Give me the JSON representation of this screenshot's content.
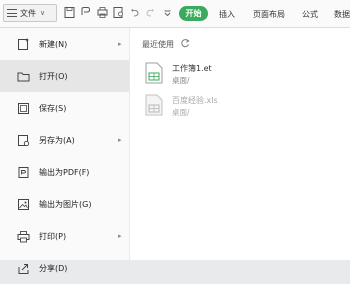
{
  "toolbar": {
    "file_menu_label": "文件",
    "tabs": {
      "start": "开始",
      "insert": "插入",
      "page_layout": "页面布局",
      "formula": "公式",
      "data": "数据"
    },
    "icons": [
      "save-icon",
      "share-icon",
      "print-icon",
      "print-preview-icon",
      "undo-icon",
      "redo-icon",
      "customize-icon"
    ],
    "accent_color": "#3aab5c"
  },
  "sidebar": {
    "items": [
      {
        "label": "新建(N)",
        "icon": "new-doc-icon",
        "has_arrow": true
      },
      {
        "label": "打开(O)",
        "icon": "folder-icon",
        "has_arrow": false
      },
      {
        "label": "保存(S)",
        "icon": "save-icon",
        "has_arrow": false
      },
      {
        "label": "另存为(A)",
        "icon": "save-as-icon",
        "has_arrow": true
      },
      {
        "label": "输出为PDF(F)",
        "icon": "pdf-icon",
        "has_arrow": false
      },
      {
        "label": "输出为图片(G)",
        "icon": "image-icon",
        "has_arrow": false
      },
      {
        "label": "打印(P)",
        "icon": "printer-icon",
        "has_arrow": true
      },
      {
        "label": "分享(D)",
        "icon": "share-icon",
        "has_arrow": false
      }
    ],
    "arrow_glyph": "▸"
  },
  "recent": {
    "title": "最近使用",
    "files": [
      {
        "name": "工作簿1.et",
        "path": "桌面/"
      },
      {
        "name": "百度经验.xls",
        "path": "桌面/"
      }
    ]
  }
}
